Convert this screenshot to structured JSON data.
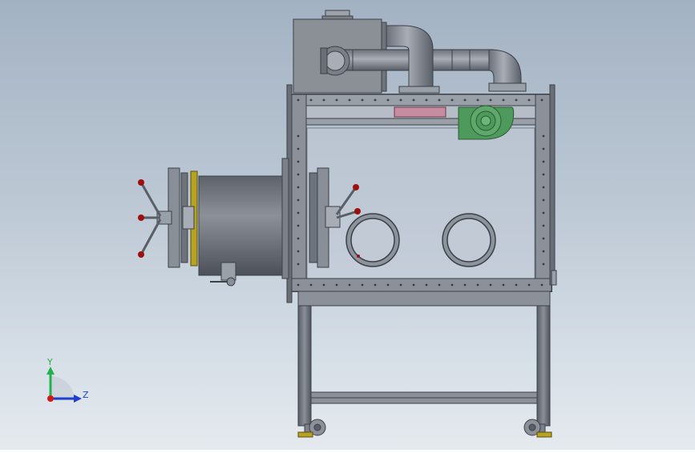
{
  "triad": {
    "y_label": "Y",
    "z_label": "Z",
    "y_color": "#22b14c",
    "z_color": "#1f3fd0",
    "origin_color": "#d01818"
  },
  "colors": {
    "steel": "#7a7f88",
    "steel_dark": "#4a4e55",
    "glass": "#c3cbd6",
    "blower": "#4e9a5c",
    "filter_pink": "#c88ca0",
    "knob": "#9a1010",
    "caster": "#b8a224"
  }
}
